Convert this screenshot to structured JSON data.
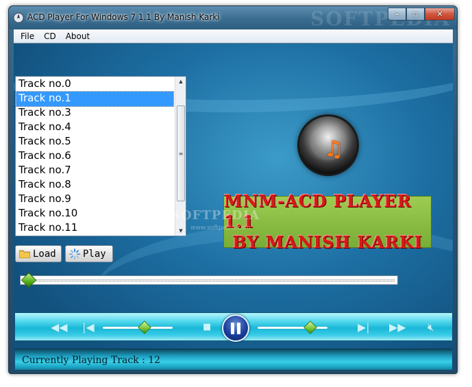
{
  "window": {
    "title": "ACD Player For Windows 7  1.1  By Manish Karki",
    "watermark": "SOFTPEDIA",
    "minimize_glyph": "–",
    "maximize_glyph": "▫",
    "close_glyph": "✕"
  },
  "menu": {
    "items": [
      {
        "label": "File"
      },
      {
        "label": "CD"
      },
      {
        "label": "About"
      }
    ]
  },
  "tracks": {
    "items": [
      {
        "label": "Track no.0"
      },
      {
        "label": "Track no.1"
      },
      {
        "label": "Track no.3"
      },
      {
        "label": "Track no.4"
      },
      {
        "label": "Track no.5"
      },
      {
        "label": "Track no.6"
      },
      {
        "label": "Track no.7"
      },
      {
        "label": "Track no.8"
      },
      {
        "label": "Track no.9"
      },
      {
        "label": "Track no.10"
      },
      {
        "label": "Track no.11"
      }
    ],
    "selected_index": 1
  },
  "banner": {
    "line1": "MNM-ACD PLAYER 1.1",
    "line2": "BY MANISH KARKI"
  },
  "overlay_watermark": {
    "text": "SOFTPEDIA",
    "url": "www.softpedia.com"
  },
  "buttons": {
    "load_label": "Load",
    "play_label": "Play"
  },
  "seek": {
    "position_fraction": 0.0
  },
  "controls": {
    "rewind_icon": "rewind-icon",
    "prev_icon": "skip-previous-icon",
    "stop_icon": "stop-icon",
    "pause_icon": "pause-icon",
    "next_icon": "skip-next-icon",
    "forward_icon": "fast-forward-icon",
    "mute_icon": "mute-icon",
    "balance_fraction": 0.6,
    "volume_fraction": 0.75
  },
  "status": {
    "text": "Currently Playing Track : 12"
  },
  "colors": {
    "selection": "#3399ff",
    "control_bar": "#19b7d7",
    "banner_bg": "#78ad36",
    "banner_text": "#d61a1a"
  }
}
